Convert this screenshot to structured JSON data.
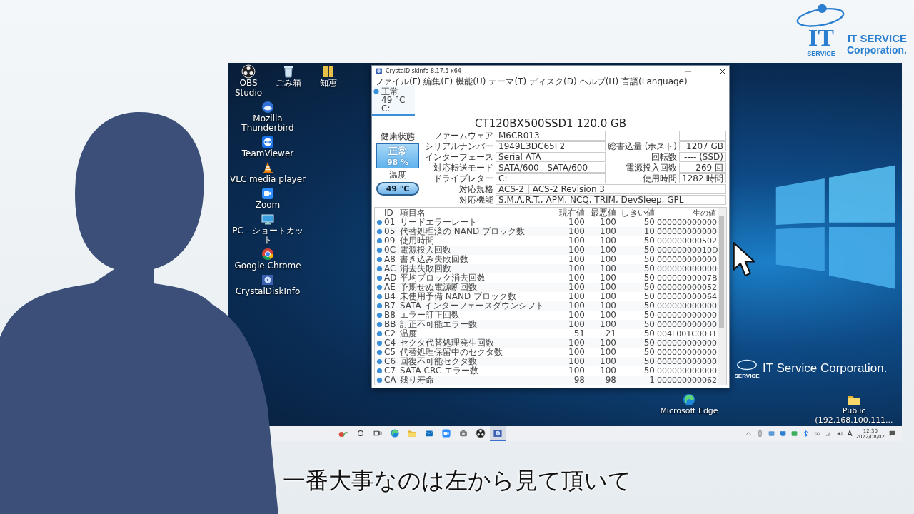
{
  "logo": {
    "emblem": "IT",
    "emblem_sub": "SERVICE",
    "name": "IT SERVICE",
    "name2": "Corporation."
  },
  "desktop": {
    "icons_top": [
      {
        "label": "OBS Studio",
        "kind": "obs"
      },
      {
        "label": "ごみ箱",
        "kind": "trash"
      },
      {
        "label": "知恵",
        "kind": "zip"
      }
    ],
    "icons_left": [
      {
        "label": "Mozilla Thunderbird",
        "kind": "thunderbird"
      },
      {
        "label": "TeamViewer",
        "kind": "teamviewer"
      },
      {
        "label": "VLC media player",
        "kind": "vlc"
      },
      {
        "label": "Zoom",
        "kind": "zoom"
      },
      {
        "label": "PC - ショートカット",
        "kind": "pc"
      },
      {
        "label": "Google Chrome",
        "kind": "chrome"
      },
      {
        "label": "CrystalDiskInfo",
        "kind": "cdi"
      }
    ],
    "icons_bottom": [
      {
        "label": "Microsoft Edge",
        "kind": "edge"
      },
      {
        "label": "Public (192.168.100.111...",
        "kind": "folder"
      }
    ],
    "wallpaper_logo": {
      "emblem_sub": "SERVICE",
      "text": "IT Service Corporation."
    }
  },
  "window": {
    "title": "CrystalDiskInfo 8.17.5 x64",
    "menu": [
      "ファイル(F)",
      "編集(E)",
      "機能(U)",
      "テーマ(T)",
      "ディスク(D)",
      "ヘルプ(H)",
      "言語(Language)"
    ],
    "disk_tabs": [
      {
        "status": "正常",
        "temp": "49 °C",
        "drive": "C:",
        "selected": true
      }
    ],
    "model": "CT120BX500SSD1 120.0 GB",
    "health": {
      "label": "健康状態",
      "status": "正常",
      "percent": "98 %"
    },
    "temperature": {
      "label": "温度",
      "value": "49 °C"
    },
    "fields": [
      {
        "label": "ファームウェア",
        "value": "M6CR013",
        "label_r": "----",
        "value_r": "----"
      },
      {
        "label": "シリアルナンバー",
        "value": "1949E3DC65F2",
        "label_r": "総書込量 (ホスト)",
        "value_r": "1207 GB"
      },
      {
        "label": "インターフェース",
        "value": "Serial ATA",
        "label_r": "回転数",
        "value_r": "---- (SSD)"
      },
      {
        "label": "対応転送モード",
        "value": "SATA/600 | SATA/600",
        "label_r": "電源投入回数",
        "value_r": "269 回"
      },
      {
        "label": "ドライブレター",
        "value": "C:",
        "label_r": "使用時間",
        "value_r": "1282 時間"
      }
    ],
    "fields_wide": [
      {
        "label": "対応規格",
        "value": "ACS-2 | ACS-2 Revision 3"
      },
      {
        "label": "対応機能",
        "value": "S.M.A.R.T., APM, NCQ, TRIM, DevSleep, GPL"
      }
    ],
    "smart": {
      "columns": [
        "ID",
        "項目名",
        "現在値",
        "最悪値",
        "しきい値",
        "生の値"
      ],
      "rows": [
        {
          "id": "01",
          "name": "リードエラーレート",
          "current": "100",
          "worst": "100",
          "threshold": "50",
          "raw": "000000000000"
        },
        {
          "id": "05",
          "name": "代替処理済の NAND ブロック数",
          "current": "100",
          "worst": "100",
          "threshold": "10",
          "raw": "000000000000"
        },
        {
          "id": "09",
          "name": "使用時間",
          "current": "100",
          "worst": "100",
          "threshold": "50",
          "raw": "000000000502"
        },
        {
          "id": "0C",
          "name": "電源投入回数",
          "current": "100",
          "worst": "100",
          "threshold": "50",
          "raw": "00000000010D"
        },
        {
          "id": "A8",
          "name": "書き込み失敗回数",
          "current": "100",
          "worst": "100",
          "threshold": "50",
          "raw": "000000000000"
        },
        {
          "id": "AC",
          "name": "消去失敗回数",
          "current": "100",
          "worst": "100",
          "threshold": "50",
          "raw": "000000000000"
        },
        {
          "id": "AD",
          "name": "平均ブロック消去回数",
          "current": "100",
          "worst": "100",
          "threshold": "50",
          "raw": "00000000007B"
        },
        {
          "id": "AE",
          "name": "予期せぬ電源断回数",
          "current": "100",
          "worst": "100",
          "threshold": "50",
          "raw": "000000000052"
        },
        {
          "id": "B4",
          "name": "未使用予備 NAND ブロック数",
          "current": "100",
          "worst": "100",
          "threshold": "50",
          "raw": "000000000064"
        },
        {
          "id": "B7",
          "name": "SATA インターフェースダウンシフト",
          "current": "100",
          "worst": "100",
          "threshold": "50",
          "raw": "000000000000"
        },
        {
          "id": "B8",
          "name": "エラー訂正回数",
          "current": "100",
          "worst": "100",
          "threshold": "50",
          "raw": "000000000000"
        },
        {
          "id": "BB",
          "name": "訂正不可能エラー数",
          "current": "100",
          "worst": "100",
          "threshold": "50",
          "raw": "000000000000"
        },
        {
          "id": "C2",
          "name": "温度",
          "current": "51",
          "worst": "21",
          "threshold": "50",
          "raw": "004F001C0031"
        },
        {
          "id": "C4",
          "name": "セクタ代替処理発生回数",
          "current": "100",
          "worst": "100",
          "threshold": "50",
          "raw": "000000000000"
        },
        {
          "id": "C5",
          "name": "代替処理保留中のセクタ数",
          "current": "100",
          "worst": "100",
          "threshold": "50",
          "raw": "000000000000"
        },
        {
          "id": "C6",
          "name": "回復不可能セクタ数",
          "current": "100",
          "worst": "100",
          "threshold": "50",
          "raw": "000000000000"
        },
        {
          "id": "C7",
          "name": "SATA CRC エラー数",
          "current": "100",
          "worst": "100",
          "threshold": "50",
          "raw": "000000000000"
        },
        {
          "id": "CA",
          "name": "残り寿命",
          "current": "98",
          "worst": "98",
          "threshold": "1",
          "raw": "000000000062"
        }
      ]
    }
  },
  "taskbar": {
    "items": [
      {
        "kind": "widget",
        "selected": false
      },
      {
        "kind": "circle",
        "selected": false
      },
      {
        "kind": "taskview",
        "selected": false
      },
      {
        "kind": "edge",
        "selected": false
      },
      {
        "kind": "folder",
        "selected": false
      },
      {
        "kind": "mail",
        "selected": false
      },
      {
        "kind": "zoom",
        "selected": false
      },
      {
        "kind": "camera",
        "selected": false
      },
      {
        "kind": "obs",
        "selected": false
      },
      {
        "kind": "cdi",
        "selected": true
      }
    ],
    "tray": [
      {
        "kind": "device"
      },
      {
        "kind": "app"
      },
      {
        "kind": "display"
      },
      {
        "kind": "app2"
      },
      {
        "kind": "bluetooth"
      },
      {
        "kind": "link"
      },
      {
        "kind": "network"
      },
      {
        "kind": "speaker"
      }
    ],
    "ime": "A",
    "time": "12:30",
    "date": "2022/08/02"
  },
  "subtitle": "一番大事なのは左から見て頂いて"
}
